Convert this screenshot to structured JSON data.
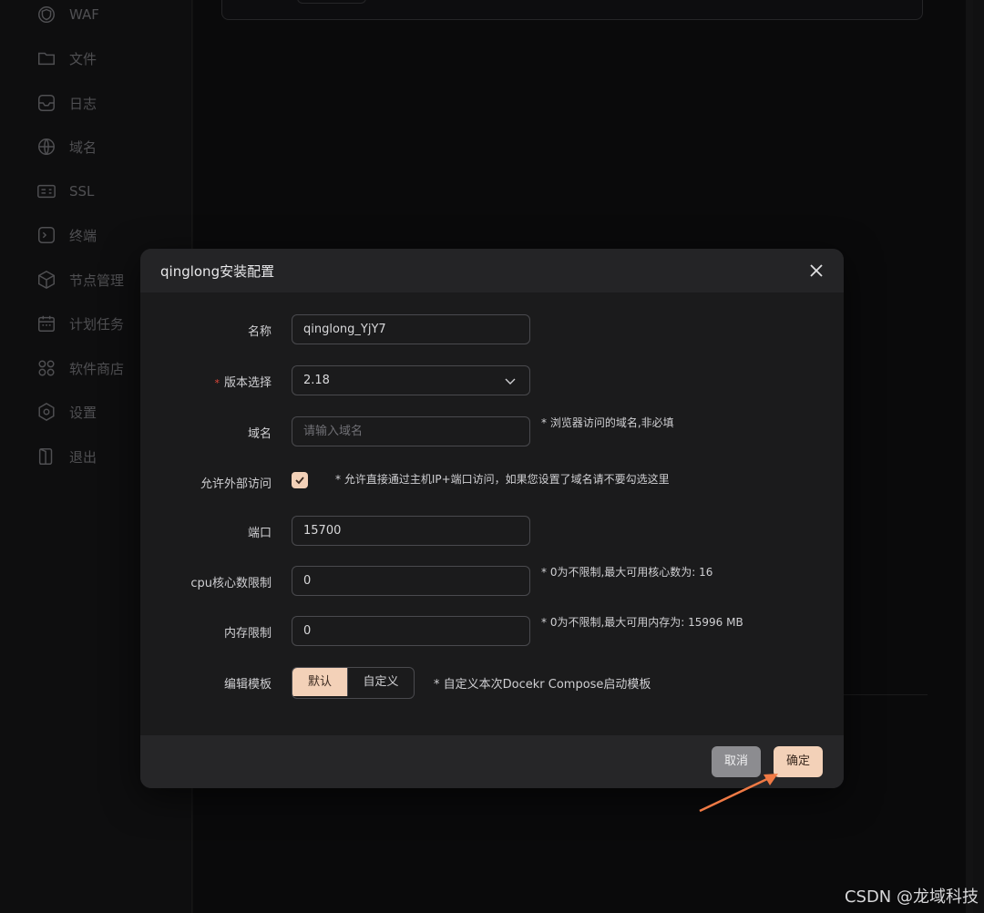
{
  "sidebar": {
    "items": [
      {
        "label": "WAF",
        "icon": "shield-icon"
      },
      {
        "label": "文件",
        "icon": "folder-icon"
      },
      {
        "label": "日志",
        "icon": "log-icon"
      },
      {
        "label": "域名",
        "icon": "globe-icon"
      },
      {
        "label": "SSL",
        "icon": "certificate-icon"
      },
      {
        "label": "终端",
        "icon": "terminal-icon"
      },
      {
        "label": "节点管理",
        "icon": "cube-icon"
      },
      {
        "label": "计划任务",
        "icon": "calendar-icon"
      },
      {
        "label": "软件商店",
        "icon": "apps-icon"
      },
      {
        "label": "设置",
        "icon": "gear-icon"
      },
      {
        "label": "退出",
        "icon": "logout-icon"
      }
    ]
  },
  "dialog": {
    "title": "qinglong安装配置",
    "fields": {
      "name": {
        "label": "名称",
        "value": "qinglong_YjY7"
      },
      "version": {
        "label": "版本选择",
        "value": "2.18",
        "required": true
      },
      "domain": {
        "label": "域名",
        "placeholder": "请输入域名",
        "hint": "* 浏览器访问的域名,非必填"
      },
      "external": {
        "label": "允许外部访问",
        "checked": true,
        "hint": "* 允许直接通过主机IP+端口访问，如果您设置了域名请不要勾选这里"
      },
      "port": {
        "label": "端口",
        "value": "15700"
      },
      "cpu": {
        "label": "cpu核心数限制",
        "value": "0",
        "hint": "* 0为不限制,最大可用核心数为: 16"
      },
      "memory": {
        "label": "内存限制",
        "value": "0",
        "hint": "* 0为不限制,最大可用内存为: 15996 MB"
      },
      "template": {
        "label": "编辑模板",
        "options": [
          "默认",
          "自定义"
        ],
        "selected": "默认",
        "hint": "* 自定义本次Docekr Compose启动模板"
      }
    },
    "cancel_label": "取消",
    "ok_label": "确定"
  },
  "watermark": "CSDN @龙域科技",
  "colors": {
    "accent": "#f3d1b8",
    "annotation_arrow": "#f07a45",
    "required": "#e0483a"
  }
}
